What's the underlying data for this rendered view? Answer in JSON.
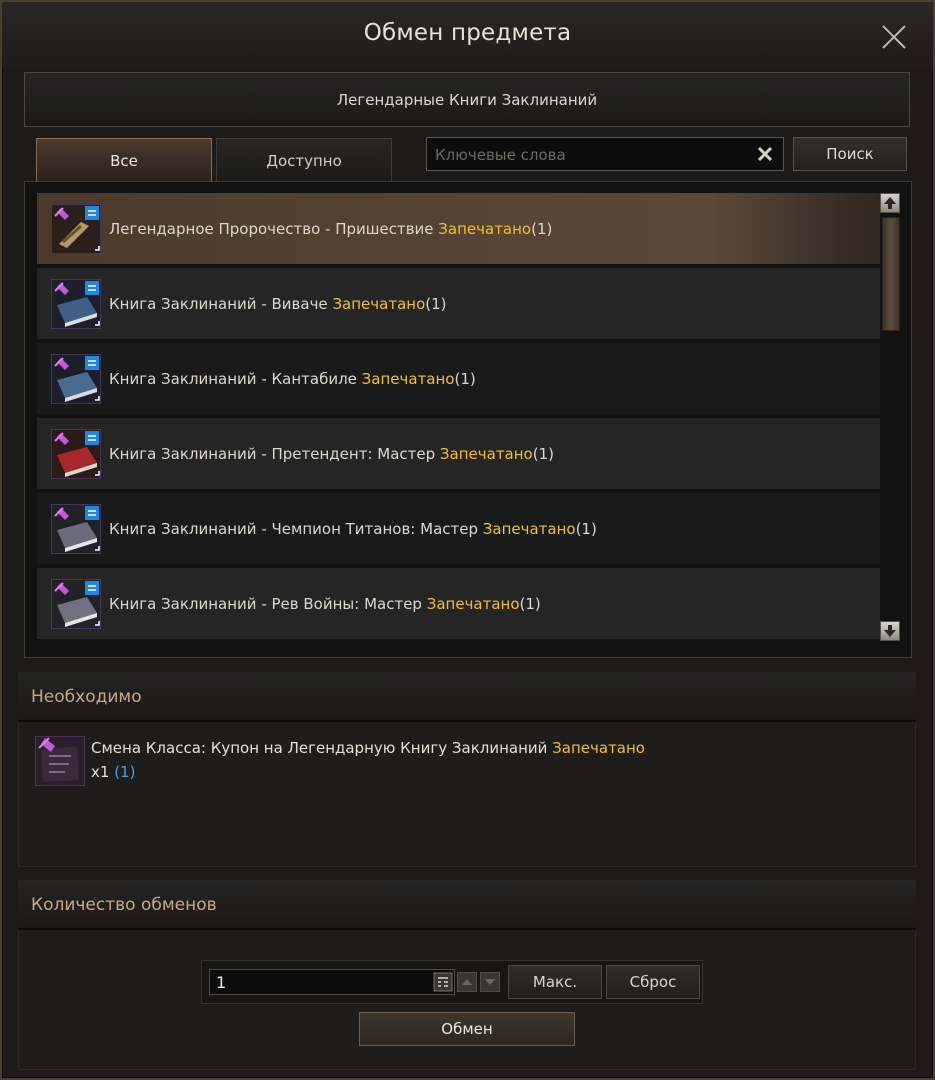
{
  "window": {
    "title": "Обмен предмета"
  },
  "category": {
    "label": "Легендарные Книги Заклинаний"
  },
  "tabs": [
    {
      "label": "Все"
    },
    {
      "label": "Доступно"
    }
  ],
  "search": {
    "placeholder": "Ключевые слова",
    "value": "",
    "button_label": "Поиск"
  },
  "items": [
    {
      "name": "Легендарное Пророчество - Пришествие ",
      "status": "Запечатано",
      "count": "(1)",
      "icon": "legendary-prophecy-icon",
      "selected": true
    },
    {
      "name": "Книга Заклинаний - Виваче ",
      "status": "Запечатано",
      "count": "(1)",
      "icon": "spellbook-blue-icon"
    },
    {
      "name": "Книга Заклинаний - Кантабиле ",
      "status": "Запечатано",
      "count": "(1)",
      "icon": "spellbook-blue-icon"
    },
    {
      "name": "Книга Заклинаний - Претендент: Мастер ",
      "status": "Запечатано",
      "count": "(1)",
      "icon": "spellbook-red-icon"
    },
    {
      "name": "Книга Заклинаний - Чемпион Титанов: Мастер ",
      "status": "Запечатано",
      "count": "(1)",
      "icon": "spellbook-gray-icon"
    },
    {
      "name": "Книга Заклинаний - Рев Войны: Мастер ",
      "status": "Запечатано",
      "count": "(1)",
      "icon": "spellbook-gray-icon"
    }
  ],
  "required": {
    "header": "Необходимо",
    "item": {
      "name": "Смена Класса: Купон на Легендарную Книгу Заклинаний ",
      "status": "Запечатано",
      "qty": "x1",
      "owned": "(1)",
      "icon": "coupon-book-icon"
    }
  },
  "exchange": {
    "header": "Количество обменов",
    "quantity": "1",
    "max_label": "Макс.",
    "reset_label": "Сброс",
    "exchange_label": "Обмен"
  },
  "colors": {
    "sealed": "#f0c030",
    "owned": "#3ea3e8",
    "header_text": "#c9a97e",
    "selected_row": "#5c4838"
  }
}
